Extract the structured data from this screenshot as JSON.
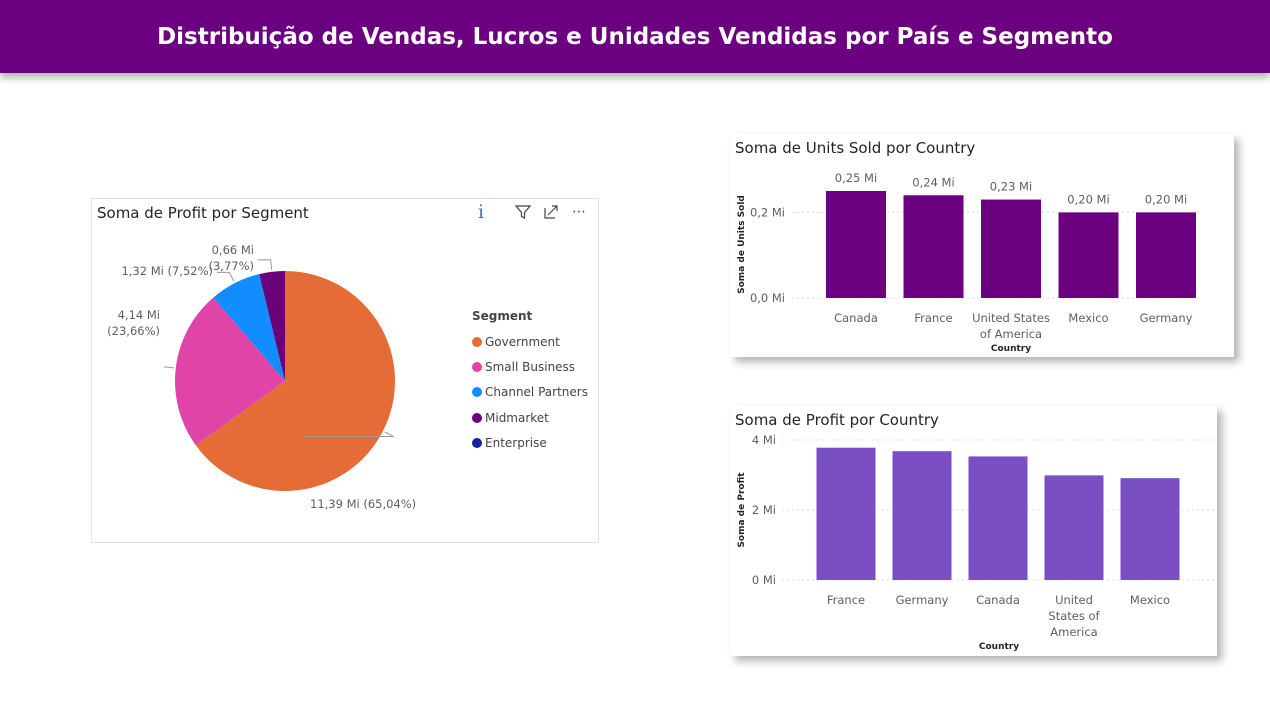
{
  "header": {
    "title": "Distribuição de Vendas, Lucros e Unidades Vendidas por País e Segmento"
  },
  "colors": {
    "header": "#6b0080",
    "units_bar": "#6b0080",
    "profit_bar": "#7b4fc4"
  },
  "pie_card": {
    "title": "Soma de Profit por Segment",
    "toolbar": [
      "info-icon",
      "filter-icon",
      "focus-mode-icon",
      "more-options-icon"
    ],
    "info_glyph": "i",
    "more_glyph": "⋯"
  },
  "units_card": {
    "title": "Soma de Units Sold por Country"
  },
  "profit_card": {
    "title": "Soma de Profit por Country"
  },
  "chart_data": [
    {
      "type": "pie",
      "title": "Soma de Profit por Segment",
      "legend_title": "Segment",
      "legend_position": "right",
      "slices": [
        {
          "name": "Government",
          "value": 11.39,
          "label": "11,39 Mi (65,04%)",
          "color": "#e66c37"
        },
        {
          "name": "Small Business",
          "value": 4.14,
          "label": "4,14 Mi (23,66%)",
          "label_lines": [
            "4,14 Mi",
            "(23,66%)"
          ],
          "color": "#e044a7"
        },
        {
          "name": "Channel Partners",
          "value": 1.32,
          "label": "1,32 Mi (7,52%)",
          "color": "#118dff"
        },
        {
          "name": "Midmarket",
          "value": 0.66,
          "label": "0,66 Mi (3,77%)",
          "label_lines": [
            "0,66 Mi",
            "(3,77%)"
          ],
          "color": "#6b007b"
        },
        {
          "name": "Enterprise",
          "value": 0,
          "label": "",
          "color": "#12239e"
        }
      ]
    },
    {
      "type": "bar",
      "title": "Soma de Units Sold por Country",
      "xlabel": "Country",
      "ylabel": "Soma de Units Sold",
      "categories": [
        "Canada",
        "France",
        "United States of America",
        "Mexico",
        "Germany"
      ],
      "category_lines": [
        [
          "Canada"
        ],
        [
          "France"
        ],
        [
          "United States",
          "of America"
        ],
        [
          "Mexico"
        ],
        [
          "Germany"
        ]
      ],
      "values": [
        0.25,
        0.24,
        0.23,
        0.2,
        0.2
      ],
      "data_labels": [
        "0,25 Mi",
        "0,24 Mi",
        "0,23 Mi",
        "0,20 Mi",
        "0,20 Mi"
      ],
      "yticks": [
        {
          "value": 0,
          "label": "0,0 Mi"
        },
        {
          "value": 0.2,
          "label": "0,2 Mi"
        }
      ],
      "ylim": [
        0,
        0.25
      ],
      "grid": true,
      "color": "#6b0080"
    },
    {
      "type": "bar",
      "title": "Soma de Profit por Country",
      "xlabel": "Country",
      "ylabel": "Soma de Profit",
      "categories": [
        "France",
        "Germany",
        "Canada",
        "United States of America",
        "Mexico"
      ],
      "category_lines": [
        [
          "France"
        ],
        [
          "Germany"
        ],
        [
          "Canada"
        ],
        [
          "United",
          "States of",
          "America"
        ],
        [
          "Mexico"
        ]
      ],
      "values": [
        3.78,
        3.68,
        3.53,
        2.99,
        2.91
      ],
      "yticks": [
        {
          "value": 0,
          "label": "0 Mi"
        },
        {
          "value": 2,
          "label": "2 Mi"
        },
        {
          "value": 4,
          "label": "4 Mi"
        }
      ],
      "ylim": [
        0,
        4
      ],
      "grid": true,
      "color": "#7b4fc4"
    }
  ]
}
